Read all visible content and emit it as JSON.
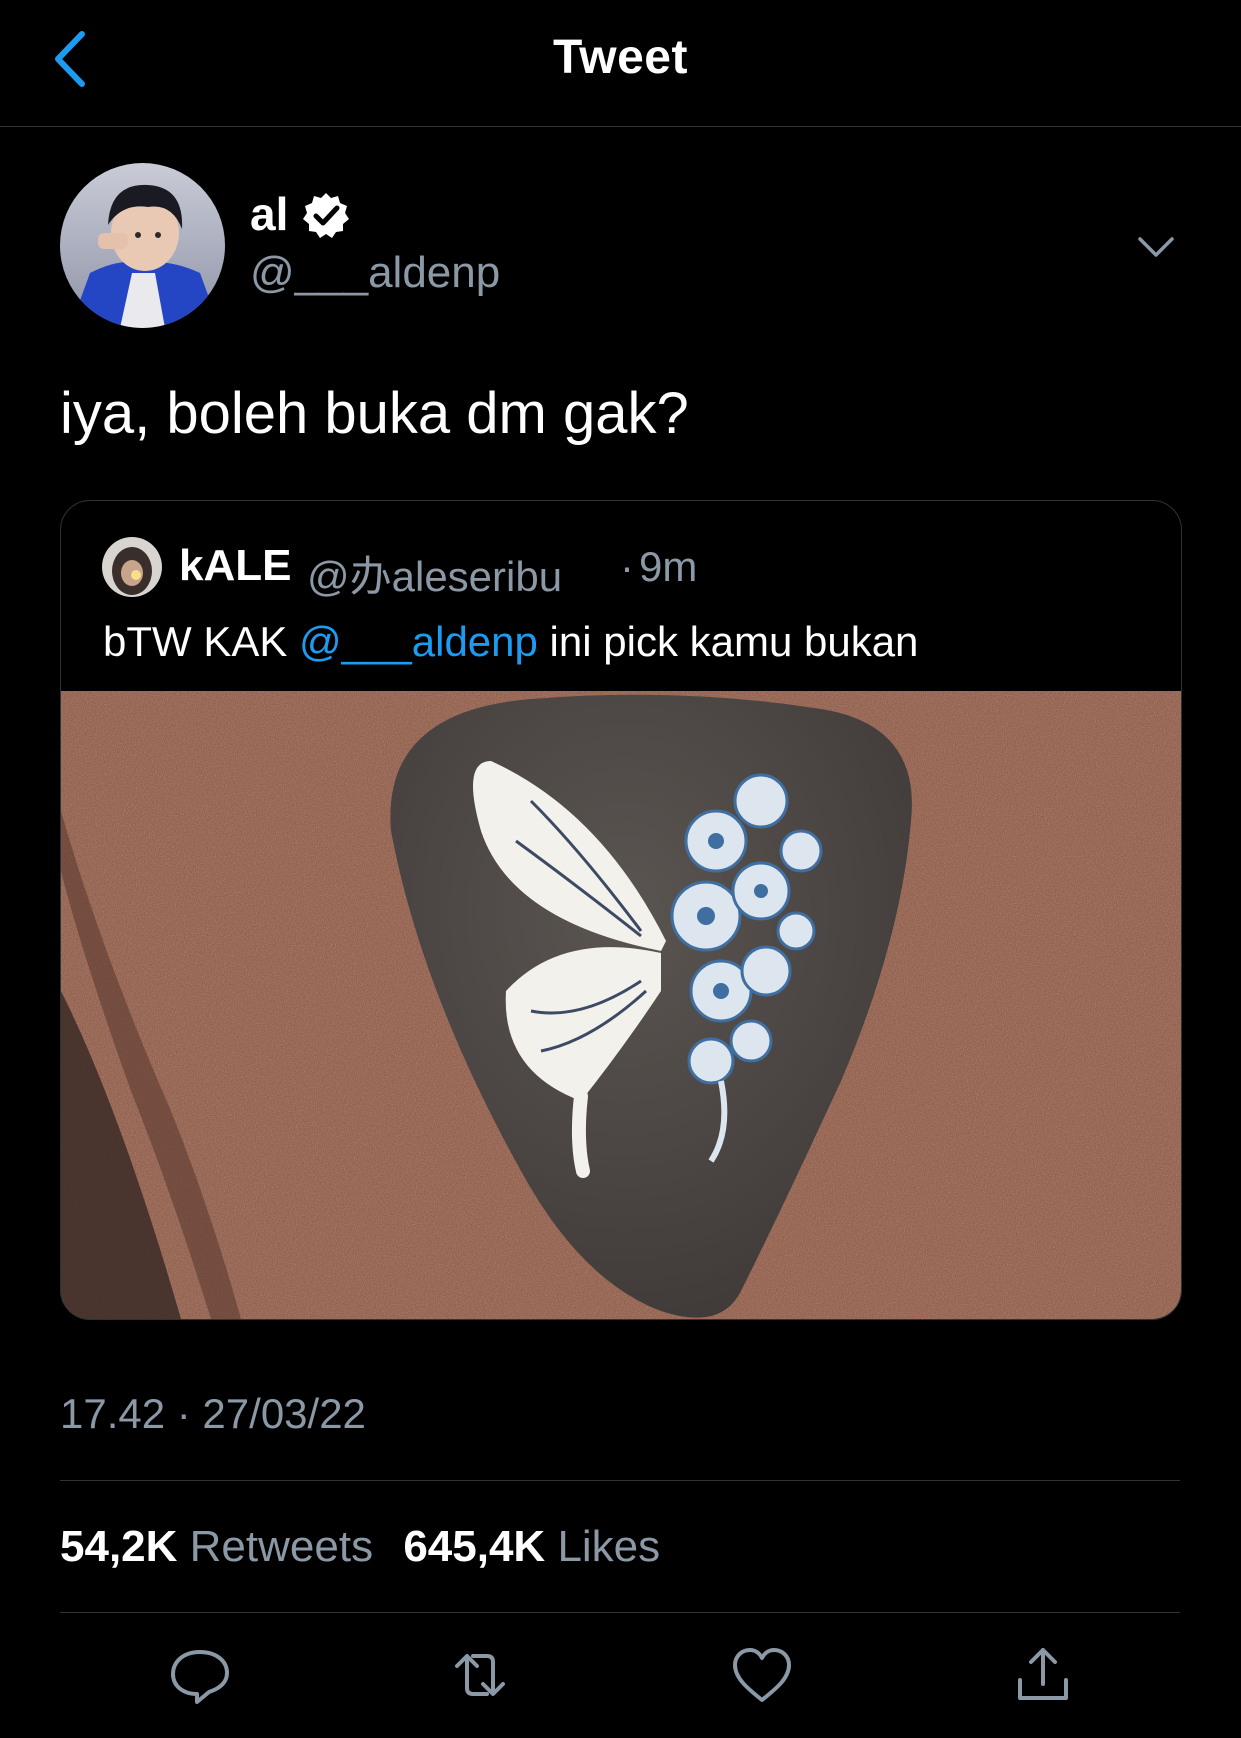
{
  "header": {
    "title": "Tweet",
    "back_icon": "chevron-left-icon"
  },
  "tweet": {
    "author_name": "al",
    "author_handle": "@___aldenp",
    "verified": true,
    "text": "iya, boleh buka dm gak?",
    "timestamp": "17.42 · 27/03/22"
  },
  "quoted_tweet": {
    "author_name": "kALE",
    "author_handle": "@办aleseribu",
    "separator": "·",
    "time": "9m",
    "text_before": "bTW KAK ",
    "mention": "@___aldenp",
    "text_after": " ini pick kamu bukan",
    "image_description_icon": "guitar-pick-photo"
  },
  "stats": {
    "retweets_count": "54,2K",
    "retweets_label": "Retweets",
    "likes_count": "645,4K",
    "likes_label": "Likes"
  },
  "actions": {
    "reply_icon": "reply-icon",
    "retweet_icon": "retweet-icon",
    "like_icon": "heart-icon",
    "share_icon": "share-icon"
  },
  "colors": {
    "background": "#000000",
    "accent": "#1d9bf0",
    "secondary_text": "#8b98a5",
    "divider": "#2f3336"
  }
}
